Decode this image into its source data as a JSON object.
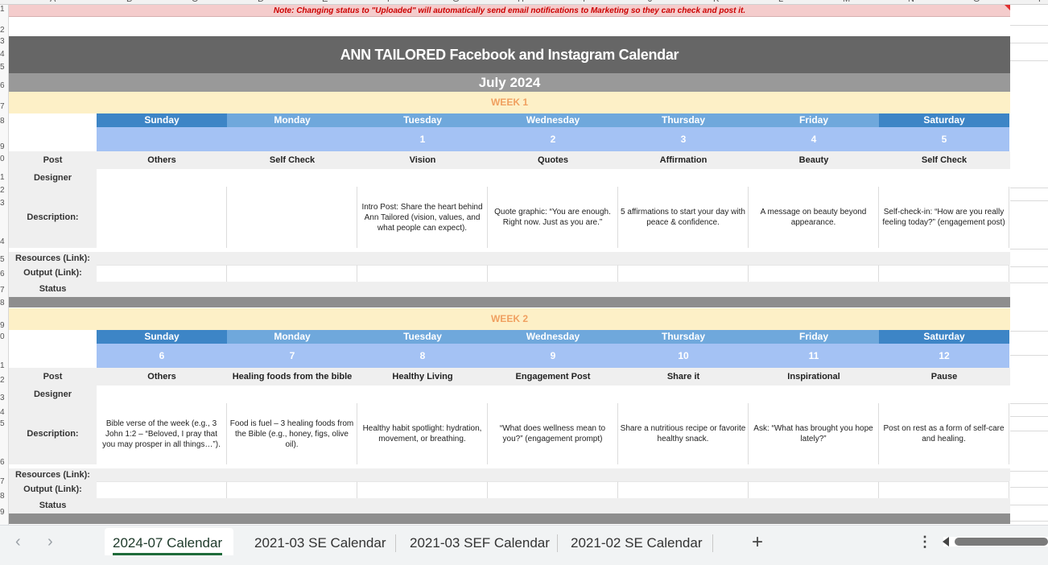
{
  "column_headers": [
    "A",
    "B",
    "C",
    "D",
    "E",
    "F",
    "G",
    "H",
    "I",
    "J",
    "K",
    "L",
    "M",
    "N",
    "O",
    "P"
  ],
  "row_numbers": [
    "1",
    "2",
    "3",
    "4",
    "5",
    "6",
    "7",
    "8",
    "9",
    "0",
    "1",
    "2",
    "3",
    "4",
    "5",
    "6",
    "7",
    "8",
    "9",
    "0",
    "1",
    "2",
    "3",
    "4",
    "5",
    "6",
    "7",
    "8",
    "9"
  ],
  "note": "Note: Changing status to \"Uploaded\" will automatically send email notifications to Marketing so they can check and post it.",
  "title": "ANN TAILORED Facebook and Instagram Calendar",
  "month": "July 2024",
  "row_labels": {
    "post": "Post",
    "designer": "Designer",
    "description": "Description:",
    "resources": "Resources (Link):",
    "output": "Output (Link):",
    "status": "Status"
  },
  "days": [
    "Sunday",
    "Monday",
    "Tuesday",
    "Wednesday",
    "Thursday",
    "Friday",
    "Saturday"
  ],
  "colors": {
    "day_dark": "#3d85c6",
    "day_light": "#6fa8dc",
    "date_row": "#a4c2f4",
    "week_band": "#fdf0c7",
    "title_band": "#666666",
    "note_text": "#cc0000"
  },
  "weeks": [
    {
      "label": "WEEK 1",
      "dates": [
        "",
        "",
        "1",
        "2",
        "3",
        "4",
        "5"
      ],
      "posts": [
        "Others",
        "Self Check",
        "Vision",
        "Quotes",
        "Affirmation",
        "Beauty",
        "Self Check"
      ],
      "descriptions": [
        "",
        "",
        "Intro Post: Share the heart behind Ann Tailored (vision, values, and what people can expect).",
        "Quote graphic: “You are enough. Right now. Just as you are.”",
        "5 affirmations to start your day with peace & confidence.",
        "A message on beauty beyond appearance.",
        "Self-check-in: “How are you really feeling today?” (engagement post)"
      ]
    },
    {
      "label": "WEEK 2",
      "dates": [
        "6",
        "7",
        "8",
        "9",
        "10",
        "11",
        "12"
      ],
      "posts": [
        "Others",
        "Healing foods from the bible",
        "Healthy Living",
        "Engagement Post",
        "Share it",
        "Inspirational",
        "Pause"
      ],
      "descriptions": [
        "Bible verse of the week (e.g., 3 John 1:2 – “Beloved, I pray that you may prosper in all things…”).",
        "Food is fuel – 3 healing foods from the Bible (e.g., honey, figs, olive oil).",
        "Healthy habit spotlight: hydration, movement, or breathing.",
        "“What does wellness mean to you?” (engagement prompt)",
        "Share a nutritious recipe or favorite healthy snack.",
        "Ask: “What has brought you hope lately?”",
        "Post on rest as a form of self-care and healing."
      ]
    }
  ],
  "tabs": {
    "active": "2024-07 Calendar",
    "others": [
      "2021-03 SE Calendar",
      "2021-03 SEF Calendar",
      "2021-02 SE Calendar"
    ],
    "add": "+",
    "more": "⋮",
    "prev": "‹",
    "next": "›"
  }
}
